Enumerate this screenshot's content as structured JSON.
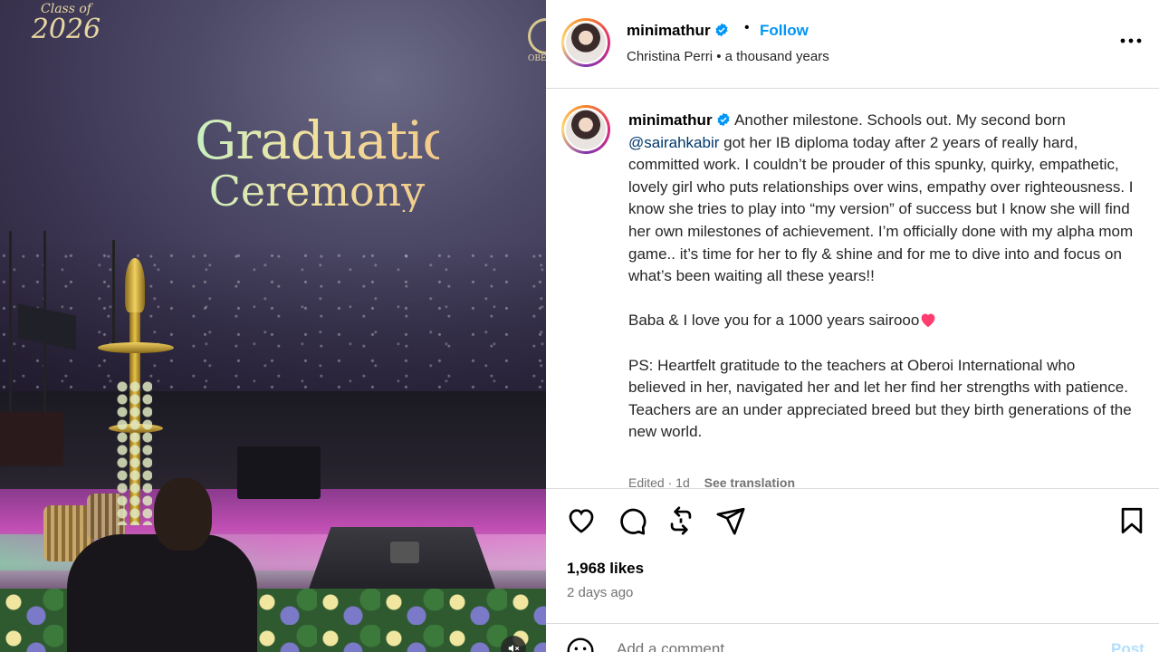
{
  "media": {
    "logo_line1": "Class of",
    "logo_line2": "2026",
    "screen_title_line1": "Graduation",
    "screen_title_line2": "Ceremony",
    "oberoi_text": "OBE"
  },
  "header": {
    "username": "minimathur",
    "separator": "•",
    "follow_label": "Follow",
    "audio": "Christina Perri • a thousand years"
  },
  "caption": {
    "username": "minimathur",
    "text_before_mention": "Another milestone. Schools out. My second born ",
    "mention": "@sairahkabir",
    "text_after_mention": " got her IB diploma today after 2 years of really hard, committed work. I couldn’t be prouder of this spunky, quirky, empathetic, lovely girl who puts relationships over wins, empathy over righteousness. I know she tries to play into “my version” of success but I know she will find her own milestones of achievement. I’m officially done with my alpha mom game.. it’s time for her to fly & shine and for me to dive into and focus on what’s been waiting all these years!!\n\nBaba & I love you for a 1000 years sairooo",
    "text_ps": "\n\nPS: Heartfelt gratitude to the teachers at Oberoi International who believed in her, navigated her and let her find her strengths with patience. Teachers are an under appreciated breed but they birth generations of the new world.",
    "edited": "Edited",
    "dot": "·",
    "age": "1d",
    "see_translation": "See translation"
  },
  "engagement": {
    "likes": "1,968 likes",
    "posted": "2 days ago"
  },
  "comment": {
    "placeholder": "Add a comment...",
    "post_label": "Post"
  },
  "colors": {
    "link_blue": "#0095f6",
    "mention": "#00376b",
    "heart": "#ff3040",
    "muted": "#737373"
  },
  "icons": [
    "verified-icon",
    "more-options-icon",
    "like-icon",
    "comment-icon",
    "repost-icon",
    "share-icon",
    "save-icon",
    "emoji-icon",
    "heart-emoji-icon",
    "mute-icon"
  ]
}
